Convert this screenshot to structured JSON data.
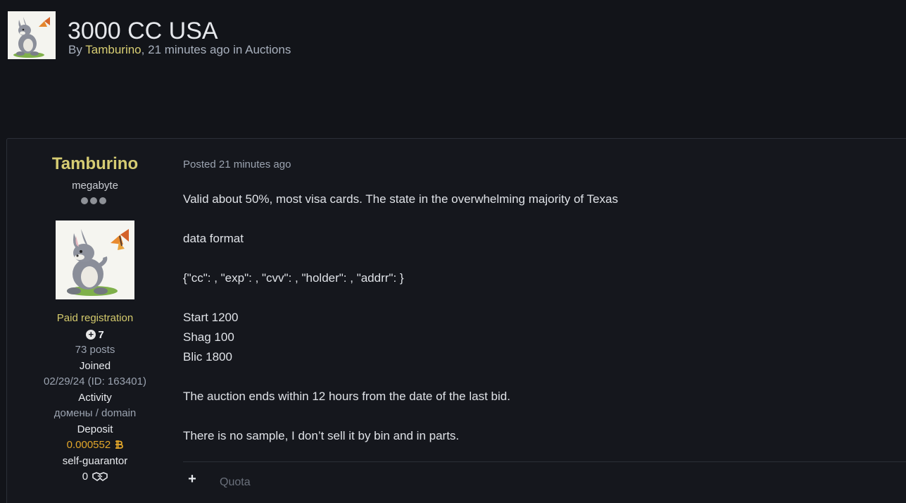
{
  "topic": {
    "title": "3000 CC USA",
    "by_prefix": "By",
    "author": "Tamburino",
    "separator": ",",
    "time_ago": "21 minutes ago",
    "in_text": "in",
    "forum": "Auctions"
  },
  "post": {
    "author": {
      "name": "Tamburino",
      "rank": "megabyte",
      "group": "Paid registration",
      "reputation": "7",
      "posts": "73 posts",
      "joined_label": "Joined",
      "joined_value": "02/29/24 (ID: 163401)",
      "activity_label": "Activity",
      "activity_value": "домены / domain",
      "deposit_label": "Deposit",
      "deposit_value": "0.000552",
      "guarantor_label": "self-guarantor",
      "guarantor_value": "0"
    },
    "posted_text": "Posted 21 minutes ago",
    "content": {
      "line1": "Valid about 50%, most visa cards. The state in the overwhelming majority of Texas",
      "line2": "data format",
      "line3": "{\"cc\": , \"exp\": , \"cvv\": , \"holder\": , \"addrr\": }",
      "line4": "Start 1200",
      "line5": "Shag 100",
      "line6": "Blic 1800",
      "line7": "The auction ends within 12 hours from the date of the last bid.",
      "line8": "There is no sample, I don’t sell it by bin and in parts."
    },
    "actions": {
      "plus_symbol": "+",
      "quote_label": "Quota"
    }
  },
  "icons": {
    "bitcoin": "bitcoin-icon",
    "handshake": "handshake-icon",
    "reputation": "reputation-plus-icon"
  },
  "colors": {
    "background": "#121419",
    "accent_yellow": "#d6cc73",
    "bitcoin_gold": "#e3a72a"
  }
}
